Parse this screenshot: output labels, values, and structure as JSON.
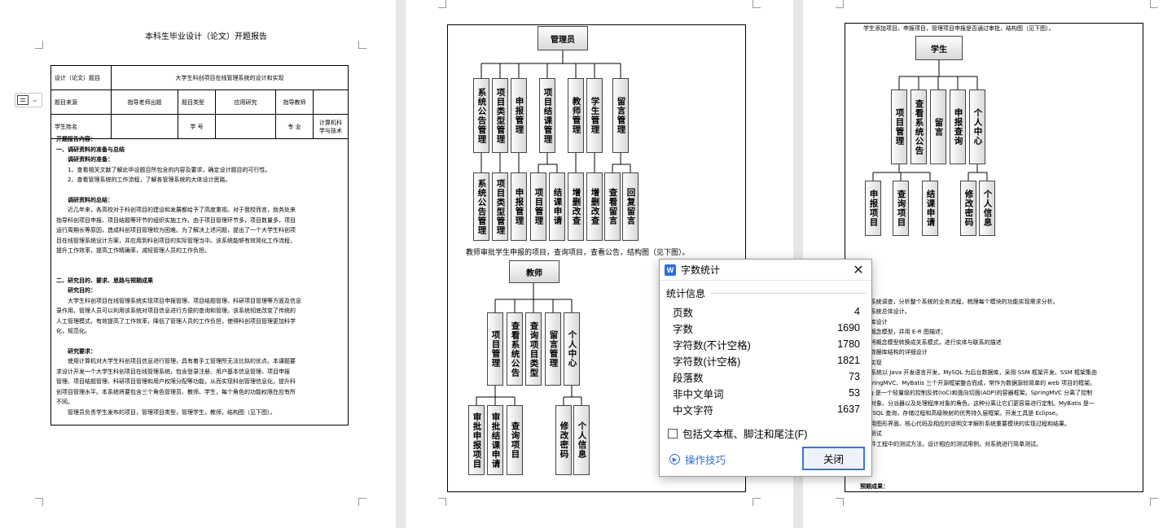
{
  "page1": {
    "title": "本科生毕业设计（论文）开题报告",
    "table": {
      "topic_label": "设计（论文）题目",
      "topic_value": "大学生科创项目在线管理系统的设计和实现",
      "source_label": "题目来源",
      "source_value": "指导老师出题",
      "type_label": "题目类型",
      "type_value": "应用研究",
      "advisor_label": "指导教师",
      "student_label": "学生姓名",
      "id_label": "学 号",
      "major_label": "专 业",
      "major_value": "计算机科学与技术"
    },
    "content": {
      "heading": "开题报告内容：",
      "s1": "一、调研资料的准备与总结",
      "s1_prep_head": "调研资料的准备：",
      "s1_prep_1": "1、查看相关文献了解此毕设题目所包含的内容及要求，确定设计题目的可行性。",
      "s1_prep_2": "2、查看管理系统的工作流程，了解各管理系统的大体设计思路。",
      "s1_sum_head": "调研资料的总结：",
      "s1_sum_l1": "近几年来，各高校对于科创项目的建设和发展都给予了高度重视。对于我校而言，就务处来",
      "s1_sum_l2": "指导科创项目申报、项目结题等环节的组织实施工作。由于项目管理环节多，项目数量多，项目",
      "s1_sum_l3": "运行周期长等原因，造成科创项目管理较为困难。为了解决上述问题，提出了一个大学生科创项",
      "s1_sum_l4": "目在线管理系统设计方案，并应用到科创项目的实际管理当中。该系统能够有效简化工作流程，",
      "s1_sum_l5": "提升工作效率，提高工作精确率，减轻管理人员的工作负担。",
      "s2": "二、研究目的、要求、思路与预期成果",
      "s2_purpose_head": "研究目的：",
      "s2_purpose_l1": "大学生科创项目在线管理系统实现项目申报管理、项目结题管理、科研项目管理等方面及信息",
      "s2_purpose_l2": "录作用，管理人员可以利用该系统对项目信息进行方便的查询和管理。该系统彻底改变了传统的",
      "s2_purpose_l3": "人工管理模式，有效提高了工作效率，降低了管理人员的工作负担，使得科创项目管理更加科学",
      "s2_purpose_l4": "化，规范化。",
      "s2_req_head": "研究要求：",
      "s2_req_l1": "使用计算机对大学生科创项目信息进行管理，具有着手工管理所无法比拟的优点。本课题要",
      "s2_req_l2": "求设计开发一个大学生科创项目在线管理系统，包含登录注册、用户基本信息管理、项目申报",
      "s2_req_l3": "管理、项目结题管理、科研项目管理和用户权限分配等功能，从而实现科创管理信息化，提升科",
      "s2_req_l4": "创项目管理水平。本系统将要包含三个角色管理员、教师、学生，每个角色的功能权限在应有所",
      "s2_req_l5": "不同。",
      "s2_req_l6": "管理员负责学生发布的项目，管理项目类型，管理学生，教师，结构图（见下图）。"
    }
  },
  "page2": {
    "admin": {
      "root": "管理员",
      "level1": [
        "系统公告管理",
        "项目类型管理",
        "申报管理",
        "项目结课管理",
        "教师管理",
        "学生管理",
        "留言管理"
      ],
      "level2": [
        "系统公告管理",
        "项目类型管理",
        "申报管理",
        "项目管理",
        "结课申请",
        "增删改查",
        "增删改查",
        "查看留言",
        "回复留言"
      ]
    },
    "caption": "教师审批学生申报的项目，查询项目，查看公告，结构图（见下图）。",
    "teacher": {
      "root": "教师",
      "level1": [
        "项目管理",
        "查看系统公告",
        "查询项目类型",
        "留言管理",
        "个人中心"
      ],
      "level2": [
        "审批申报项目",
        "审批结课申请",
        "查询项目",
        "修改密码",
        "个人信息"
      ]
    }
  },
  "page3": {
    "caption_top": "学生添加项目，申报项目，管理项目申报是否通过审批，结构图（见下图）。",
    "student": {
      "root": "学生",
      "level1": [
        "项目管理",
        "查看系统公告",
        "留言",
        "申报查询",
        "个人中心"
      ],
      "level2": [
        "申报项目",
        "查询项目",
        "结课申请",
        "修改密码",
        "个人信息"
      ]
    },
    "lines": [
      "究思路：",
      "1  完成系统调查，分析整个系统的业务流程，梳理每个模块的功能实现需求分析。",
      "2  进行系统总体设计。",
      "3  数据库设计",
      "　　1 概念模型，并用 E-R 图描述；",
      "　　2 将概念模型转换成关系模式，进行实体与联系的描述",
      "　　3 数据库结构的详细设计",
      "4  系统实现",
      "　　本系统以 Java 开发语言开发，MySQL 为后台数据库，采用 SSM 框架开发。SSM 框架集由",
      "　　SpringMVC、MyBatis 三个开源框架整合而成，常作为数据源较简单的 web 项目的框架。",
      "　　ing 是一个轻量级的控制反转(IoC)和面向切面(AOP)的容器框架。SpringMVC 分离了控制",
      "　　型对象、分派器以及处理程序对象的角色，这种分离让它们更容易进行定制。MyBatis 是一",
      "　　通 SQL 查询，存储过程和高级映射的优秀持久层框架。开发工具是 Eclipse。",
      "　　使用图形界面、核心代码及相应的说明文字解析系统重要模块的实现过程和结果。",
      "5  系统测试",
      "　　软件工程中的测试方法，设计相应的测试用例，对系统进行简单测试。"
    ],
    "bottom": "预期成果："
  },
  "dialog": {
    "title": "字数统计",
    "logo": "W",
    "section": "统计信息",
    "stats": [
      {
        "label": "页数",
        "value": "4"
      },
      {
        "label": "字数",
        "value": "1690"
      },
      {
        "label": "字符数(不计空格)",
        "value": "1780"
      },
      {
        "label": "字符数(计空格)",
        "value": "1821"
      },
      {
        "label": "段落数",
        "value": "73"
      },
      {
        "label": "非中文单词",
        "value": "53"
      },
      {
        "label": "中文字符",
        "value": "1637"
      }
    ],
    "checkbox": "包括文本框、脚注和尾注(F)",
    "tips": "操作技巧",
    "close_button": "关闭",
    "close_glyph": "✕"
  }
}
